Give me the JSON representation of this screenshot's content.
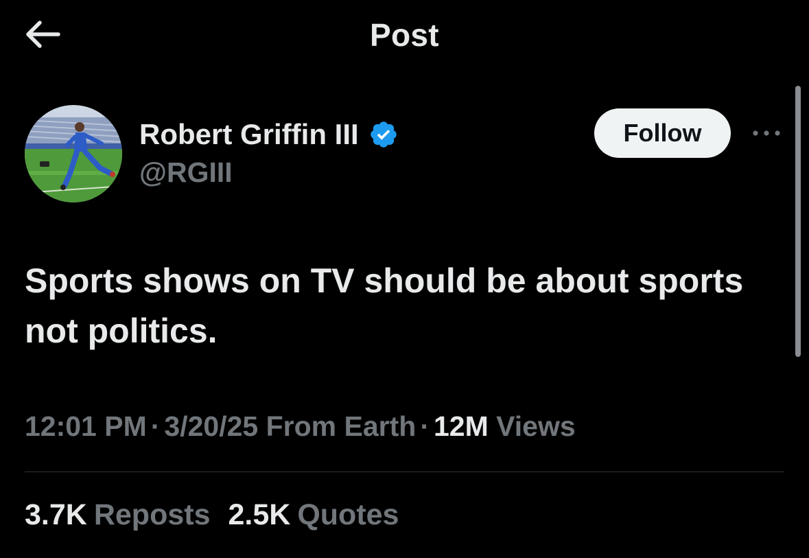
{
  "header": {
    "title": "Post",
    "back_icon": "arrow-left-icon"
  },
  "author": {
    "display_name": "Robert Griffin III",
    "handle": "@RGIII",
    "verified": true,
    "verified_color": "#1d9bf0"
  },
  "actions": {
    "follow_label": "Follow",
    "more_icon": "more-horizontal-icon"
  },
  "post": {
    "text": "Sports shows on TV should be about sports not politics."
  },
  "meta": {
    "time": "12:01 PM",
    "date": "3/20/25",
    "source": "From Earth",
    "separator": "·",
    "views_count": "12M",
    "views_label": "Views"
  },
  "stats": [
    {
      "count": "3.7K",
      "label": "Reposts"
    },
    {
      "count": "2.5K",
      "label": "Quotes"
    }
  ],
  "colors": {
    "background": "#000000",
    "primary_text": "#e7e9ea",
    "secondary_text": "#71767b",
    "divider": "#2f3336",
    "follow_bg": "#eff3f4"
  }
}
